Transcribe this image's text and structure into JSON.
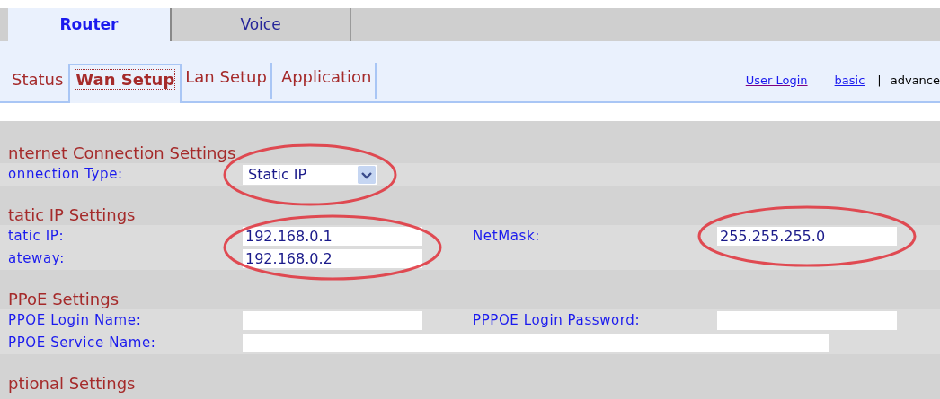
{
  "main_tabs": [
    {
      "label": "Router",
      "selected": true
    },
    {
      "label": "Voice",
      "selected": false
    }
  ],
  "sub_tabs": [
    {
      "label": "Status",
      "selected": false,
      "focused": false,
      "divider": false
    },
    {
      "label": "Wan Setup",
      "selected": true,
      "focused": true,
      "divider": false
    },
    {
      "label": "Lan Setup",
      "selected": false,
      "focused": false,
      "divider": true
    },
    {
      "label": "Application",
      "selected": false,
      "focused": false,
      "divider": true
    }
  ],
  "header_links": [
    {
      "label": "User Login"
    }
  ],
  "modes": [
    {
      "label": "basic",
      "selected": false
    },
    {
      "label": "advance",
      "selected": true
    }
  ],
  "mode_separator": "|",
  "sections": [
    {
      "title": "nternet Connection Settings",
      "rows": [
        {
          "fields": [
            {
              "label": "onnection Type:",
              "kind": "select",
              "value": "Static IP",
              "circled": true
            }
          ]
        }
      ]
    },
    {
      "title": "tatic IP Settings",
      "rows": [
        {
          "fields": [
            {
              "label": "tatic IP:",
              "kind": "text",
              "value": "192.168.0.1",
              "circled": true
            },
            {
              "label": "NetMask:",
              "kind": "text",
              "value": "255.255.255.0",
              "circled": true
            }
          ]
        },
        {
          "fields": [
            {
              "label": "ateway:",
              "kind": "text",
              "value": "192.168.0.2",
              "circled": true
            }
          ]
        }
      ]
    },
    {
      "title": "PPoE Settings",
      "rows": [
        {
          "fields": [
            {
              "label": "PPOE Login Name:",
              "kind": "text",
              "circled": false
            },
            {
              "label": "PPPOE Login Password:",
              "kind": "text",
              "circled": false
            }
          ]
        },
        {
          "fields": [
            {
              "label": "PPOE Service Name:",
              "kind": "wide_text",
              "circled": false
            }
          ]
        }
      ]
    },
    {
      "title": "ptional Settings"
    }
  ]
}
